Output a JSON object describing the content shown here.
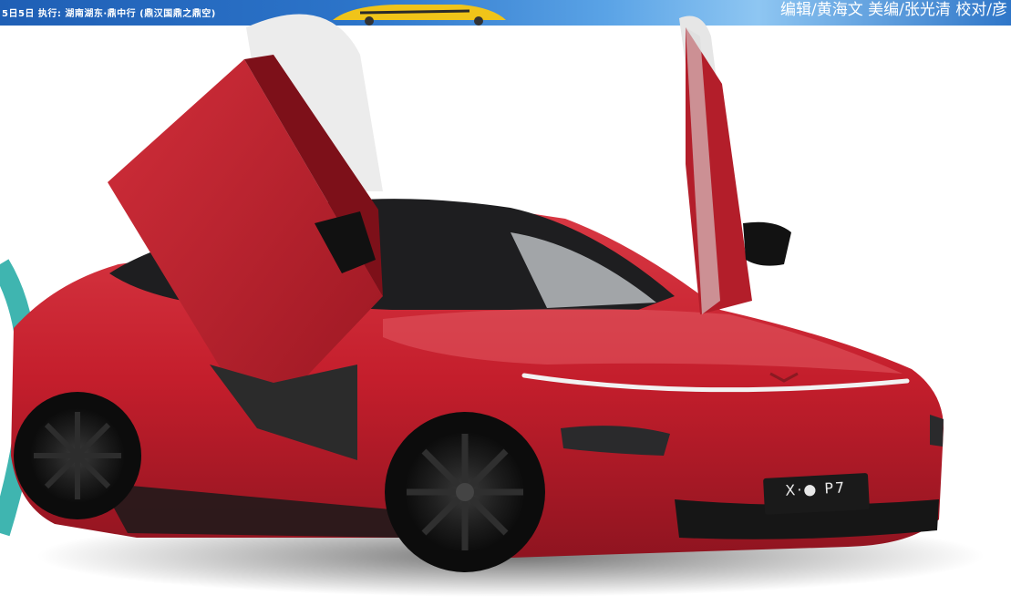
{
  "banner": {
    "left_text": "5日5日  执行: 湖南湖东·鼎中行 (鼎汉国鼎之鼎空)",
    "right_text": "编辑/黄海文  美编/张光清  校对/彦"
  },
  "car": {
    "plate": "X·● P7",
    "body_color": "#c41e2c",
    "accent_color": "#3fb5b0"
  }
}
